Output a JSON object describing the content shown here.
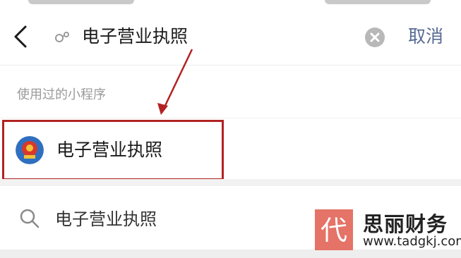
{
  "header": {
    "search_query": "电子营业执照",
    "cancel_label": "取消",
    "back_icon": "chevron-left-icon",
    "clear_icon": "clear-x-icon",
    "mini_program_icon": "mini-program-icon"
  },
  "recent_section": {
    "label": "使用过的小程序",
    "items": [
      {
        "title": "电子营业执照",
        "icon": "national-emblem-icon"
      }
    ]
  },
  "search_suggestion": {
    "text": "电子营业执照",
    "icon": "search-icon"
  },
  "watermark": {
    "logo_char": "代",
    "name": "思丽财务",
    "url": "www.tadgkj.com"
  },
  "colors": {
    "cancel_link": "#576b95",
    "annotation_red": "#b22222",
    "text_primary": "#1a1a1a",
    "text_secondary": "#9a9a9a",
    "section_band": "#f2f2f2"
  }
}
